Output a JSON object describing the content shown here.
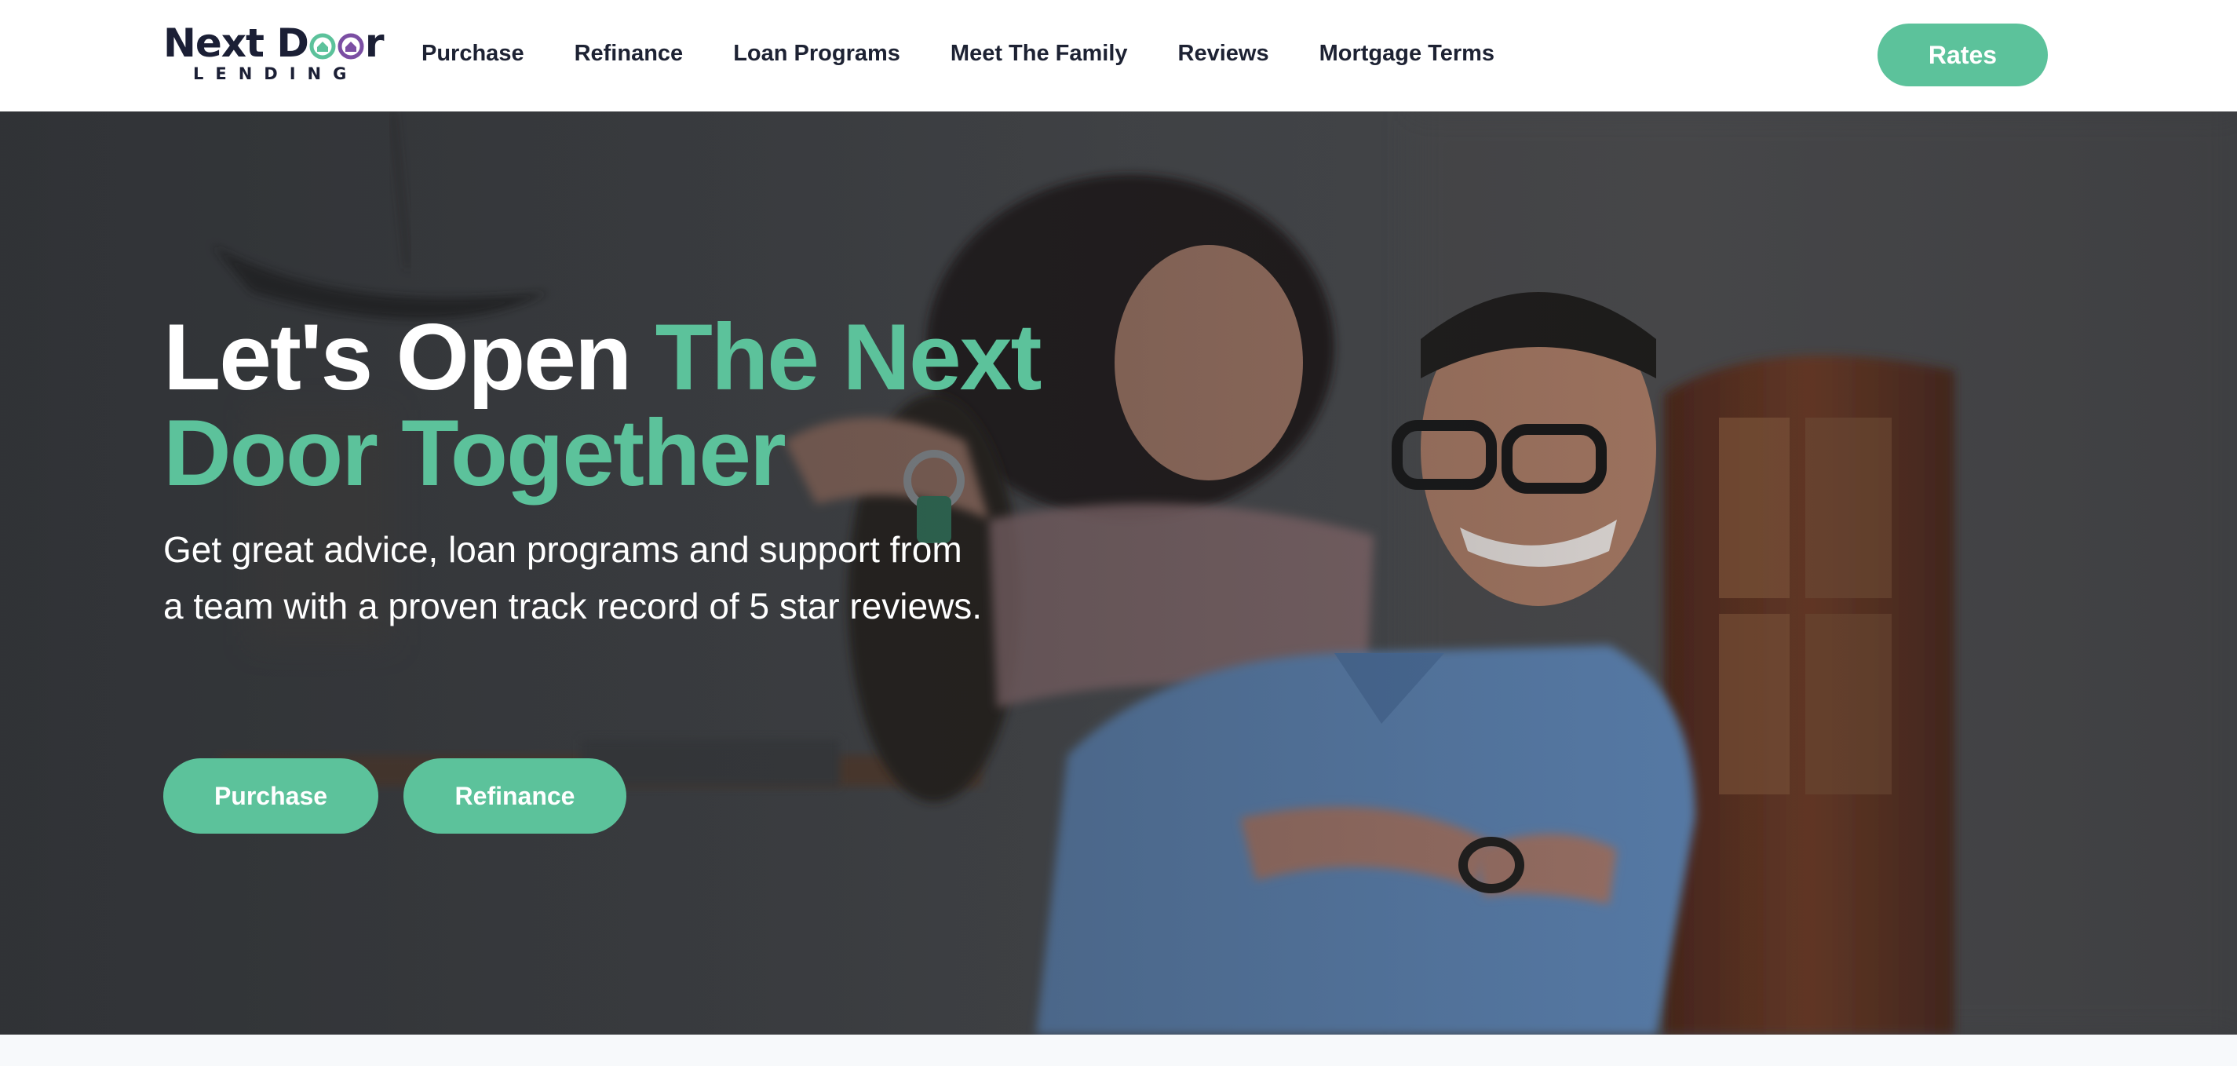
{
  "brand": {
    "name_part1": "Next D",
    "name_part2": "r",
    "subline": "LENDING",
    "colors": {
      "dark": "#1b1f35",
      "green": "#5cc29b",
      "purple": "#7b4ea3"
    }
  },
  "nav": {
    "items": [
      {
        "label": "Purchase"
      },
      {
        "label": "Refinance"
      },
      {
        "label": "Loan Programs"
      },
      {
        "label": "Meet The Family"
      },
      {
        "label": "Reviews"
      },
      {
        "label": "Mortgage Terms"
      }
    ],
    "cta_label": "Rates"
  },
  "hero": {
    "title_white": "Let's Open ",
    "title_accent": "The Next Door Together",
    "subtitle": "Get great advice, loan programs and support from a team with a proven track record of 5 star reviews.",
    "buttons": {
      "purchase": "Purchase",
      "refinance": "Refinance"
    },
    "accent_color": "#5cc29b"
  }
}
